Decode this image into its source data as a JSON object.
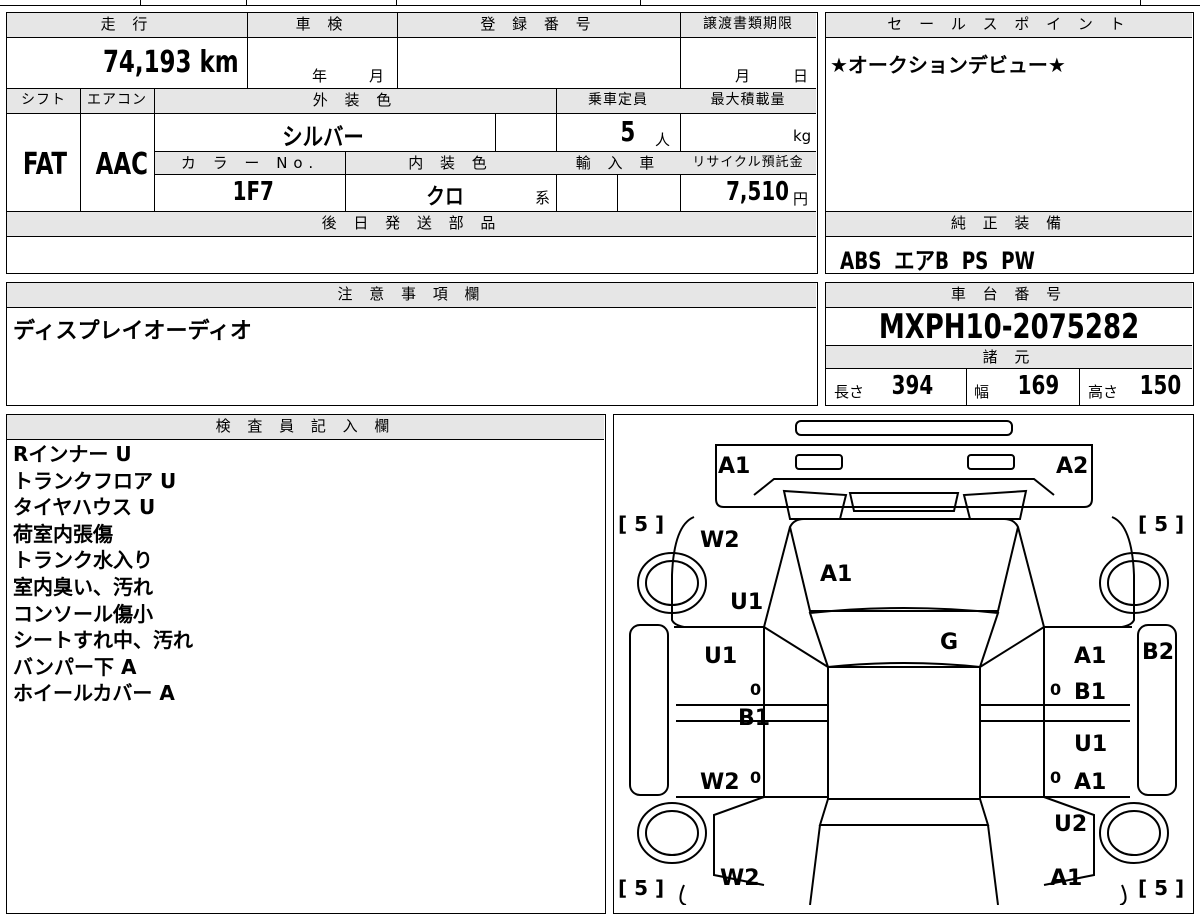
{
  "vehicle": {
    "mileage_label": "走 行",
    "mileage": "74,193 km",
    "inspection_label": "車 検",
    "inspection_year_unit": "年",
    "inspection_month_unit": "月",
    "registration_label": "登 録 番 号",
    "transfer_label": "譲渡書類期限",
    "transfer_month_unit": "月",
    "transfer_day_unit": "日",
    "shift_label": "シフト",
    "shift": "FAT",
    "ac_label": "エアコン",
    "ac": "AAC",
    "exterior_color_label": "外 装 色",
    "exterior_color": "シルバー",
    "capacity_label": "乗車定員",
    "capacity": "5",
    "capacity_unit": "人",
    "max_load_label": "最大積載量",
    "max_load_unit": "kg",
    "color_no_label": "カ ラ ー No.",
    "color_no": "1F7",
    "interior_color_label": "内 装 色",
    "interior_color": "クロ",
    "interior_suffix": "系",
    "import_label": "輸 入 車",
    "recycle_label": "リサイクル預託金",
    "recycle_fee": "7,510",
    "recycle_unit": "円",
    "later_parts_label": "後 日 発 送 部 品"
  },
  "sales_point": {
    "label": "セ ー ル ス ポ イ ン ト",
    "text": "★オークションデビュー★"
  },
  "equipment": {
    "label": "純 正 装 備",
    "text": "ABS  エアB  PS  PW"
  },
  "notice": {
    "label": "注 意 事 項 欄",
    "text": "ディスプレイオーディオ"
  },
  "chassis": {
    "label": "車 台 番 号",
    "number": "MXPH10-2075282",
    "specs_label": "諸 元",
    "length_label": "長さ",
    "length": "394",
    "width_label": "幅",
    "width": "169",
    "height_label": "高さ",
    "height": "150"
  },
  "inspector": {
    "label": "検 査 員 記 入 欄",
    "lines": [
      "Rインナー U",
      "トランクフロア U",
      "タイヤハウス U",
      "荷室内張傷",
      "トランク水入り",
      "室内臭い、汚れ",
      "コンソール傷小",
      "シートすれ中、汚れ",
      "バンパー下 A",
      "ホイールカバー A"
    ]
  },
  "diagram": {
    "labels": {
      "front_bumper_left": "A1",
      "front_bumper_right": "A2",
      "hood": "A1",
      "front_left_fender_1": "W2",
      "front_left_fender_2": "U1",
      "front_left_door": "U1",
      "left_sill": "B1",
      "rear_left_door": "W2",
      "rear_left_fender": "W2",
      "windshield": "G",
      "front_right_door_1": "A1",
      "front_right_door_2": "B1",
      "right_pillar": "B2",
      "rear_right_door_1": "U1",
      "rear_right_door_2": "A1",
      "rear_right_fender_1": "U2",
      "rear_right_fender_2": "A1",
      "tire_fl": "[ 5 ]",
      "tire_fr": "[ 5 ]",
      "tire_rl": "[ 5 ]",
      "tire_rr": "[ 5 ]",
      "zero_1": "0",
      "zero_2": "0",
      "zero_3": "0",
      "zero_4": "0"
    }
  }
}
